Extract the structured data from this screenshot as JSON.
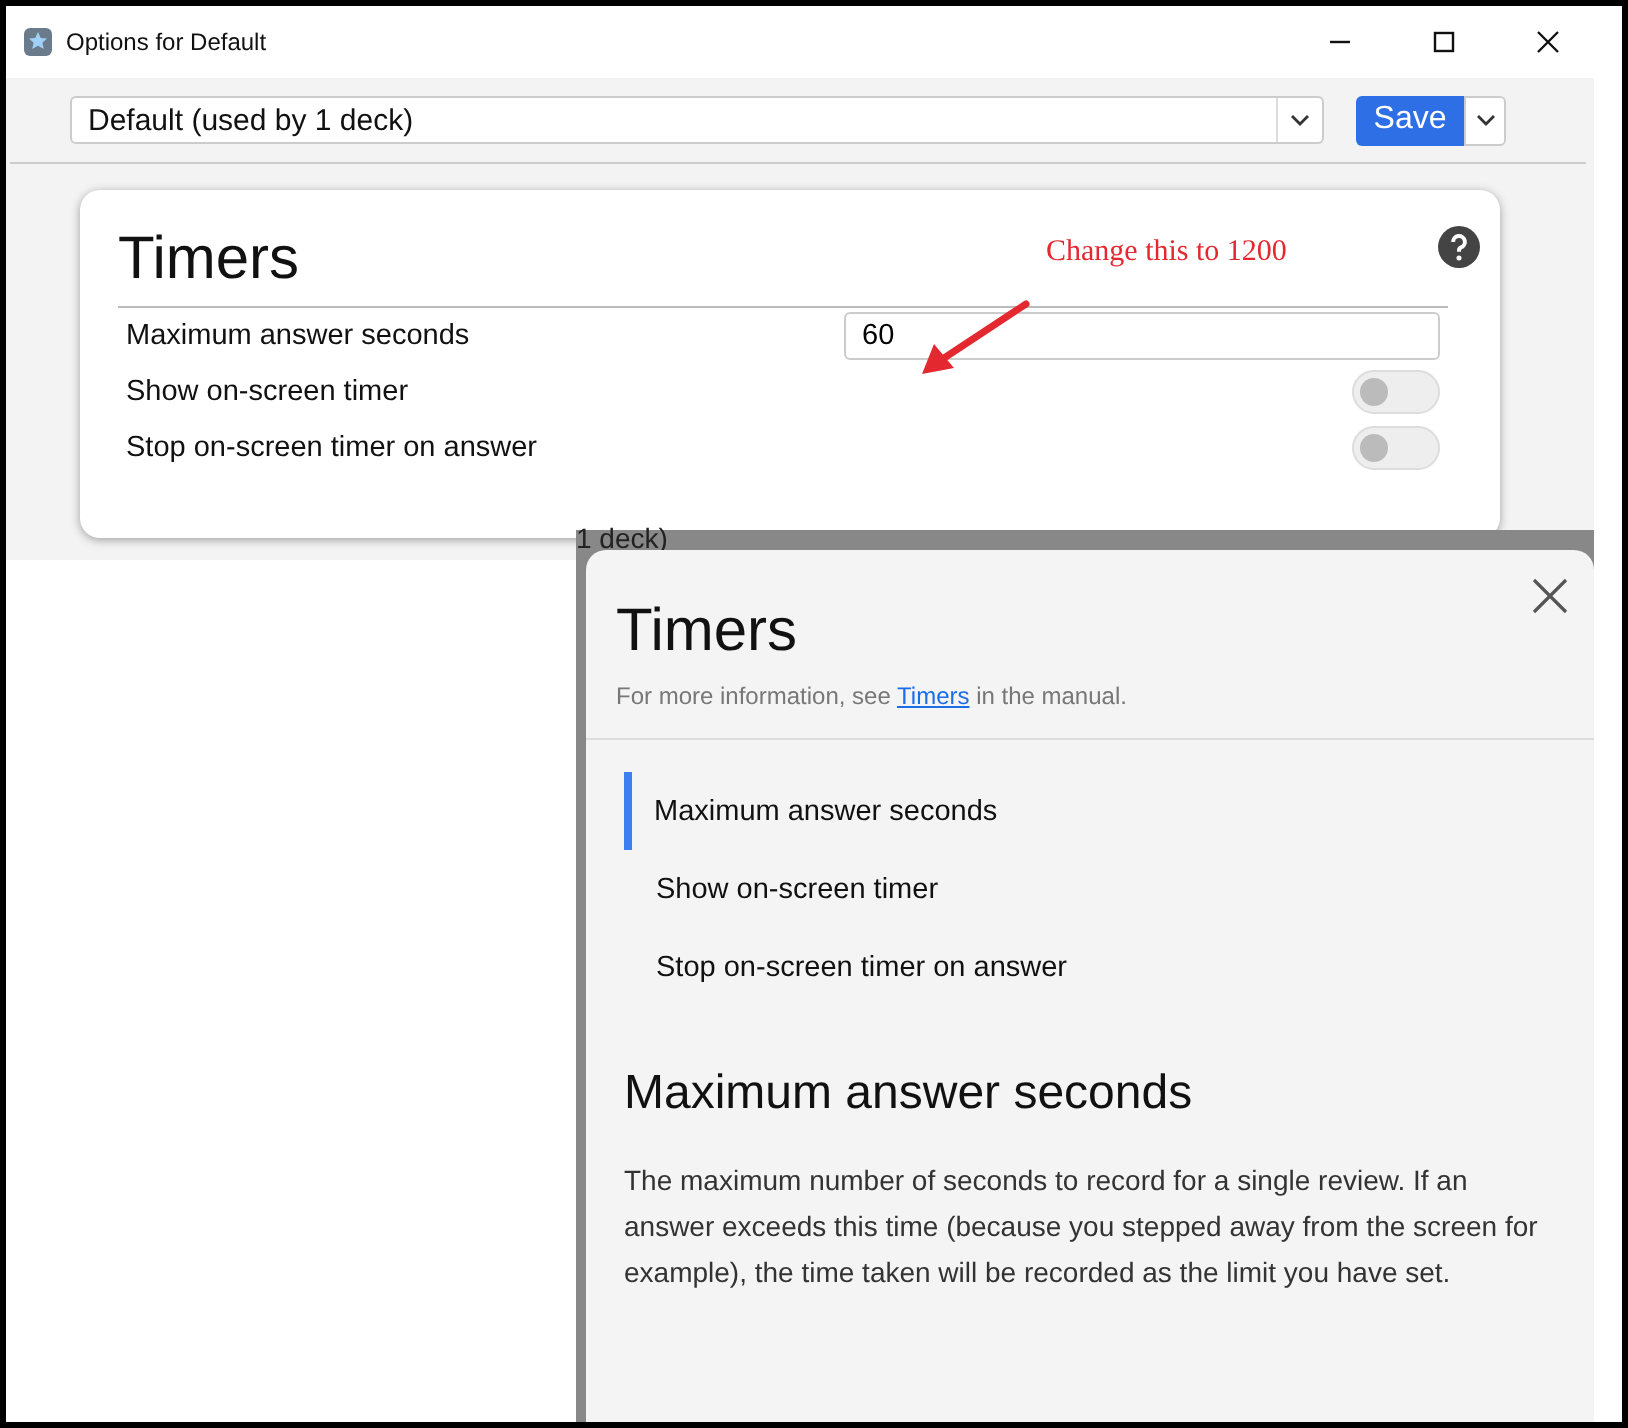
{
  "window": {
    "title": "Options for Default"
  },
  "preset": {
    "value": "Default (used by 1 deck)"
  },
  "save_button": {
    "label": "Save"
  },
  "section": {
    "title": "Timers"
  },
  "settings": [
    {
      "kind": "number",
      "label": "Maximum answer seconds",
      "value": "60"
    },
    {
      "kind": "toggle",
      "label": "Show on-screen timer",
      "on": false
    },
    {
      "kind": "toggle",
      "label": "Stop on-screen timer on answer",
      "on": false
    }
  ],
  "annotation": {
    "text": "Change this to 1200"
  },
  "help_popup": {
    "backdrop_text": "1 deck)",
    "title": "Timers",
    "intro": {
      "before": "For more information, see ",
      "link": "Timers",
      "after": " in the manual."
    },
    "items": [
      {
        "label": "Maximum answer seconds",
        "selected": true
      },
      {
        "label": "Show on-screen timer",
        "selected": false
      },
      {
        "label": "Stop on-screen timer on answer",
        "selected": false
      }
    ],
    "heading": "Maximum answer seconds",
    "body": "The maximum number of seconds to record for a single review. If an answer exceeds this time (because you stepped away from the screen for example), the time taken will be recorded as the limit you have set."
  }
}
